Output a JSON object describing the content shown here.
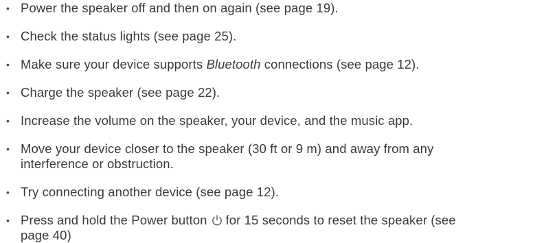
{
  "bullet_glyph": "•",
  "items": [
    {
      "text": "Power the speaker off and then on again (see page 19)."
    },
    {
      "text": "Check the status lights (see page 25)."
    },
    {
      "pre": "Make sure your device supports ",
      "emph": "Bluetooth",
      "post": " connections (see page 12)."
    },
    {
      "text": "Charge the speaker (see page 22)."
    },
    {
      "text": "Increase the volume on the speaker, your device, and the music app."
    },
    {
      "line1": "Move your device closer to the speaker (30 ft or 9 m) and away from any",
      "line2": "interference or obstruction."
    },
    {
      "text": "Try connecting another device (see page 12)."
    },
    {
      "pre": "Press and hold the Power button",
      "icon": "power-icon",
      "post": "for 15 seconds to reset the speaker (see",
      "line2": "page 40)"
    }
  ]
}
